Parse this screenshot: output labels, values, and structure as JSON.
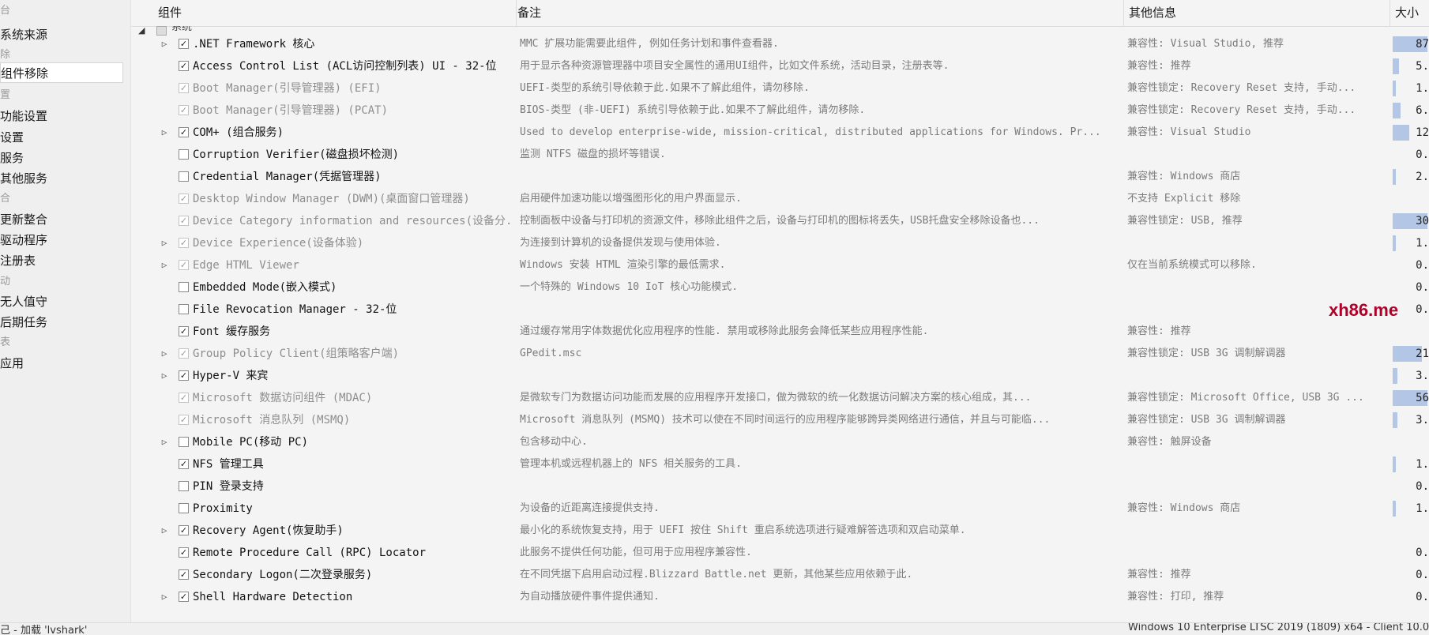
{
  "sidebar": {
    "items": [
      {
        "label": "台",
        "kind": "cat"
      },
      {
        "label": "系统来源",
        "kind": "item"
      },
      {
        "label": "除",
        "kind": "cat"
      },
      {
        "label": "组件移除",
        "kind": "item",
        "selected": true
      },
      {
        "label": "置",
        "kind": "cat"
      },
      {
        "label": "功能设置",
        "kind": "item"
      },
      {
        "label": "设置",
        "kind": "item"
      },
      {
        "label": "服务",
        "kind": "item"
      },
      {
        "label": "其他服务",
        "kind": "item"
      },
      {
        "label": "合",
        "kind": "cat"
      },
      {
        "label": "更新整合",
        "kind": "item"
      },
      {
        "label": "驱动程序",
        "kind": "item"
      },
      {
        "label": "注册表",
        "kind": "item"
      },
      {
        "label": "动",
        "kind": "cat"
      },
      {
        "label": "无人值守",
        "kind": "item"
      },
      {
        "label": "后期任务",
        "kind": "item"
      },
      {
        "label": "表",
        "kind": "cat"
      },
      {
        "label": "应用",
        "kind": "item"
      }
    ]
  },
  "table": {
    "headers": {
      "component": "组件",
      "note": "备注",
      "info": "其他信息",
      "size": "大小"
    },
    "group": {
      "label": "系统"
    },
    "rows": [
      {
        "expand": true,
        "checked": true,
        "locked": false,
        "name": ".NET Framework 核心",
        "note": "MMC 扩展功能需要此组件, 例如任务计划和事件查看器.",
        "info": "兼容性: Visual Studio, 推荐",
        "size": "87",
        "bar": 0.95
      },
      {
        "expand": false,
        "checked": true,
        "locked": false,
        "name": "Access Control List (ACL访问控制列表) UI - 32-位",
        "note": "用于显示各种资源管理器中项目安全属性的通用UI组件，比如文件系统，活动目录，注册表等.",
        "info": "兼容性: 推荐",
        "size": "5.",
        "bar": 0.18
      },
      {
        "expand": false,
        "checked": true,
        "locked": true,
        "name": "Boot Manager(引导管理器) (EFI)",
        "note": "UEFI-类型的系统引导依赖于此.如果不了解此组件，请勿移除.",
        "info": "兼容性锁定: Recovery Reset 支持, 手动...",
        "size": "1.",
        "bar": 0.04
      },
      {
        "expand": false,
        "checked": true,
        "locked": true,
        "name": "Boot Manager(引导管理器) (PCAT)",
        "note": "BIOS-类型 (非-UEFI) 系统引导依赖于此.如果不了解此组件，请勿移除.",
        "info": "兼容性锁定: Recovery Reset 支持, 手动...",
        "size": "6.",
        "bar": 0.22
      },
      {
        "expand": true,
        "checked": true,
        "locked": false,
        "name": "COM+ (组合服务)",
        "note": "Used to develop enterprise-wide, mission-critical, distributed applications for Windows. Pr...",
        "info": "兼容性: Visual Studio",
        "size": "12",
        "bar": 0.45
      },
      {
        "expand": false,
        "checked": false,
        "locked": false,
        "name": "Corruption Verifier(磁盘损坏检测)",
        "note": "监测 NTFS 磁盘的损坏等错误.",
        "info": "",
        "size": "0.",
        "bar": 0.0
      },
      {
        "expand": false,
        "checked": false,
        "locked": false,
        "name": "Credential Manager(凭据管理器)",
        "note": "",
        "info": "兼容性: Windows 商店",
        "size": "2.",
        "bar": 0.08
      },
      {
        "expand": false,
        "checked": true,
        "locked": true,
        "name": "Desktop Window Manager (DWM)(桌面窗口管理器)",
        "note": "启用硬件加速功能以增强图形化的用户界面显示.",
        "info": "不支持 Explicit 移除",
        "size": "",
        "bar": 0.0
      },
      {
        "expand": false,
        "checked": true,
        "locked": true,
        "name": "Device Category information and resources(设备分...",
        "note": "控制面板中设备与打印机的资源文件，移除此组件之后，设备与打印机的图标将丢失，USB托盘安全移除设备也...",
        "info": "兼容性锁定: USB, 推荐",
        "size": "30",
        "bar": 0.95
      },
      {
        "expand": true,
        "checked": true,
        "locked": true,
        "name": "Device Experience(设备体验)",
        "note": "为连接到计算机的设备提供发现与使用体验.",
        "info": "",
        "size": "1.",
        "bar": 0.04
      },
      {
        "expand": true,
        "checked": true,
        "locked": true,
        "name": "Edge HTML Viewer",
        "note": "Windows 安装 HTML 渲染引擎的最低需求.",
        "info": "仅在当前系统模式可以移除.",
        "size": "0.",
        "bar": 0.0
      },
      {
        "expand": false,
        "checked": false,
        "locked": false,
        "name": "Embedded Mode(嵌入模式)",
        "note": "一个特殊的 Windows 10 IoT 核心功能模式.",
        "info": "",
        "size": "0.",
        "bar": 0.0
      },
      {
        "expand": false,
        "checked": false,
        "locked": false,
        "name": "File Revocation Manager - 32-位",
        "note": "",
        "info": "",
        "size": "0.",
        "bar": 0.0
      },
      {
        "expand": false,
        "checked": true,
        "locked": false,
        "name": "Font 缓存服务",
        "note": "通过缓存常用字体数据优化应用程序的性能. 禁用或移除此服务会降低某些应用程序性能.",
        "info": "兼容性: 推荐",
        "size": "",
        "bar": 0.0
      },
      {
        "expand": true,
        "checked": true,
        "locked": true,
        "name": "Group Policy Client(组策略客户端)",
        "note": "GPedit.msc",
        "info": "兼容性锁定: USB 3G 调制解调器",
        "size": "21",
        "bar": 0.8
      },
      {
        "expand": true,
        "checked": true,
        "locked": false,
        "name": "Hyper-V 来宾",
        "note": "",
        "info": "",
        "size": "3.",
        "bar": 0.12
      },
      {
        "expand": false,
        "checked": true,
        "locked": true,
        "name": "Microsoft 数据访问组件 (MDAC)",
        "note": "是微软专门为数据访问功能而发展的应用程序开发接口，做为微软的统一化数据访问解决方案的核心组成，其...",
        "info": "兼容性锁定: Microsoft Office, USB 3G ...",
        "size": "56",
        "bar": 0.95
      },
      {
        "expand": false,
        "checked": true,
        "locked": true,
        "name": "Microsoft 消息队列 (MSMQ)",
        "note": "Microsoft 消息队列 (MSMQ) 技术可以使在不同时间运行的应用程序能够跨异类网络进行通信，并且与可能临...",
        "info": "兼容性锁定: USB 3G 调制解调器",
        "size": "3.",
        "bar": 0.14
      },
      {
        "expand": true,
        "checked": false,
        "locked": false,
        "name": "Mobile PC(移动 PC)",
        "note": "包含移动中心.",
        "info": "兼容性: 触屏设备",
        "size": "",
        "bar": 0.0
      },
      {
        "expand": false,
        "checked": true,
        "locked": false,
        "name": "NFS 管理工具",
        "note": "管理本机或远程机器上的 NFS 相关服务的工具.",
        "info": "",
        "size": "1.",
        "bar": 0.04
      },
      {
        "expand": false,
        "checked": false,
        "locked": false,
        "name": "PIN 登录支持",
        "note": "",
        "info": "",
        "size": "0.",
        "bar": 0.0
      },
      {
        "expand": false,
        "checked": false,
        "locked": false,
        "name": "Proximity",
        "note": "为设备的近距离连接提供支持.",
        "info": "兼容性: Windows 商店",
        "size": "1.",
        "bar": 0.04
      },
      {
        "expand": true,
        "checked": true,
        "locked": false,
        "name": "Recovery Agent(恢复助手)",
        "note": "最小化的系统恢复支持，用于 UEFI 按住 Shift 重启系统选项进行疑难解答选项和双启动菜单.",
        "info": "",
        "size": "",
        "bar": 0.0
      },
      {
        "expand": false,
        "checked": true,
        "locked": false,
        "name": "Remote Procedure Call (RPC) Locator",
        "note": "此服务不提供任何功能，但可用于应用程序兼容性.",
        "info": "",
        "size": "0.",
        "bar": 0.0
      },
      {
        "expand": false,
        "checked": true,
        "locked": false,
        "name": "Secondary Logon(二次登录服务)",
        "note": "在不同凭据下启用启动过程.Blizzard Battle.net 更新，其他某些应用依赖于此.",
        "info": "兼容性: 推荐",
        "size": "0.",
        "bar": 0.0
      },
      {
        "expand": true,
        "checked": true,
        "locked": false,
        "name": "Shell Hardware Detection",
        "note": "为自动播放硬件事件提供通知.",
        "info": "兼容性: 打印, 推荐",
        "size": "0.",
        "bar": 0.0
      }
    ]
  },
  "watermark": "xh86.me",
  "statusbar": {
    "left": "己 - 加载 'lvshark'",
    "right": "Windows 10 Enterprise LTSC 2019 (1809) x64 - Client 10.0"
  },
  "colors": {
    "size_bar": "#b3c6e6",
    "watermark": "#b0002a"
  }
}
